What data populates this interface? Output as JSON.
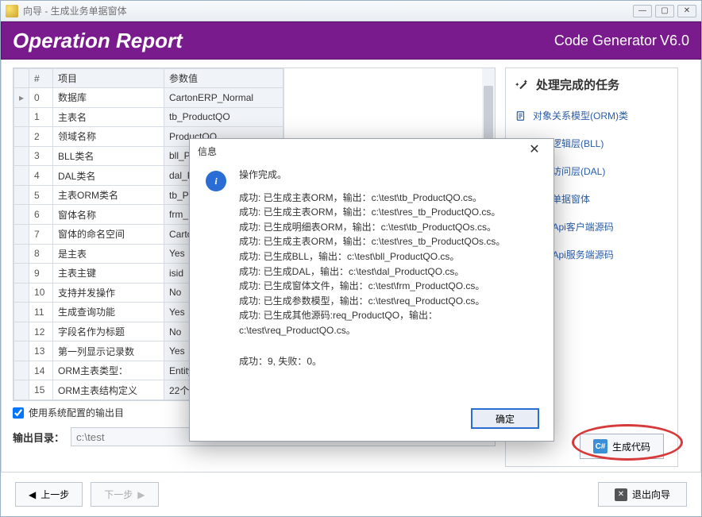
{
  "window_title": "向导 - 生成业务单据窗体",
  "banner": {
    "title": "Operation Report",
    "product": "Code Generator",
    "version": "V6.0"
  },
  "grid": {
    "headers": {
      "num": "#",
      "name": "项目",
      "value": "参数值"
    },
    "rows": [
      {
        "n": "0",
        "name": "数据库",
        "value": "CartonERP_Normal"
      },
      {
        "n": "1",
        "name": "主表名",
        "value": "tb_ProductQO"
      },
      {
        "n": "2",
        "name": "领域名称",
        "value": "ProductQO"
      },
      {
        "n": "3",
        "name": "BLL类名",
        "value": "bll_P"
      },
      {
        "n": "4",
        "name": "DAL类名",
        "value": "dal_P"
      },
      {
        "n": "5",
        "name": "主表ORM类名",
        "value": "tb_P"
      },
      {
        "n": "6",
        "name": "窗体名称",
        "value": "frm_"
      },
      {
        "n": "7",
        "name": "窗体的命名空间",
        "value": "Carto"
      },
      {
        "n": "8",
        "name": "是主表",
        "value": "Yes"
      },
      {
        "n": "9",
        "name": "主表主键",
        "value": "isid"
      },
      {
        "n": "10",
        "name": "支持并发操作",
        "value": "No"
      },
      {
        "n": "11",
        "name": "生成查询功能",
        "value": "Yes"
      },
      {
        "n": "12",
        "name": "字段名作为标题",
        "value": "No"
      },
      {
        "n": "13",
        "name": "第一列显示记录数",
        "value": "Yes"
      },
      {
        "n": "14",
        "name": "ORM主表类型：",
        "value": "Entity"
      },
      {
        "n": "15",
        "name": "ORM主表结构定义",
        "value": "22个"
      }
    ]
  },
  "checkbox_label": "使用系统配置的输出目",
  "output": {
    "label": "输出目录：",
    "value": "c:\\test"
  },
  "side": {
    "title": "处理完成的任务",
    "items": [
      "对象关系模型(ORM)类",
      "业务逻辑层(BLL)",
      "数据访问层(DAL)",
      "业务单据窗体",
      "WebApi客户端源码",
      "WebApi服务端源码"
    ]
  },
  "generate_label": "生成代码",
  "nav": {
    "prev": "上一步",
    "next": "下一步",
    "exit": "退出向导"
  },
  "modal": {
    "title": "信息",
    "header": "操作完成。",
    "lines": [
      "成功: 已生成主表ORM，输出：c:\\test\\tb_ProductQO.cs。",
      "成功: 已生成主表ORM，输出：c:\\test\\res_tb_ProductQO.cs。",
      "成功: 已生成明细表ORM，输出：c:\\test\\tb_ProductQOs.cs。",
      "成功: 已生成主表ORM，输出：c:\\test\\res_tb_ProductQOs.cs。",
      "成功: 已生成BLL，输出：c:\\test\\bll_ProductQO.cs。",
      "成功: 已生成DAL，输出：c:\\test\\dal_ProductQO.cs。",
      "成功: 已生成窗体文件，输出：c:\\test\\frm_ProductQO.cs。",
      "成功: 已生成参数模型，输出：c:\\test\\req_ProductQO.cs。",
      "成功: 已生成其他源码:req_ProductQO，输出：c:\\test\\req_ProductQO.cs。"
    ],
    "summary": "成功：9, 失败：0。",
    "ok": "确定"
  }
}
